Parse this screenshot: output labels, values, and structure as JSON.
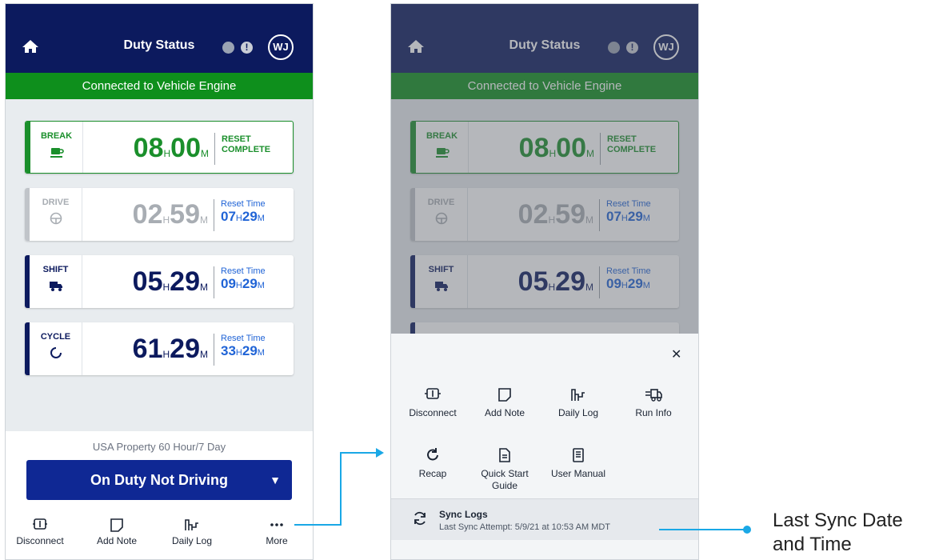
{
  "header": {
    "title": "Duty Status",
    "avatar_initials": "WJ",
    "icons": [
      "home-icon",
      "globe-icon",
      "alert-icon"
    ]
  },
  "connection_banner": "Connected to Vehicle Engine",
  "clocks": {
    "break": {
      "label": "BREAK",
      "hours": "08",
      "minutes": "00",
      "h_unit": "H",
      "m_unit": "M",
      "status_line1": "RESET",
      "status_line2": "COMPLETE",
      "icon": "coffee-icon"
    },
    "drive": {
      "label": "DRIVE",
      "hours": "02",
      "minutes": "59",
      "h_unit": "H",
      "m_unit": "M",
      "reset_label": "Reset Time",
      "reset_hours": "07",
      "reset_minutes": "29",
      "icon": "steering-wheel-icon"
    },
    "shift": {
      "label": "SHIFT",
      "hours": "05",
      "minutes": "29",
      "h_unit": "H",
      "m_unit": "M",
      "reset_label": "Reset Time",
      "reset_hours": "09",
      "reset_minutes": "29",
      "icon": "truck-icon"
    },
    "cycle": {
      "label": "CYCLE",
      "hours": "61",
      "minutes": "29",
      "h_unit": "H",
      "m_unit": "M",
      "reset_label": "Reset Time",
      "reset_hours": "33",
      "reset_minutes": "29",
      "icon": "cycle-icon"
    }
  },
  "ruleset": "USA Property 60 Hour/7 Day",
  "duty_button": "On Duty Not Driving",
  "bottom_nav": {
    "disconnect": "Disconnect",
    "add_note": "Add Note",
    "daily_log": "Daily Log",
    "more": "More"
  },
  "more_menu": {
    "disconnect": "Disconnect",
    "add_note": "Add Note",
    "daily_log": "Daily Log",
    "run_info": "Run Info",
    "recap": "Recap",
    "quick_start_line1": "Quick Start",
    "quick_start_line2": "Guide",
    "user_manual": "User Manual",
    "sync_title": "Sync Logs",
    "sync_sub": "Last Sync Attempt: 5/9/21 at 10:53 AM MDT"
  },
  "annotation": {
    "line1": "Last Sync Date",
    "line2": "and Time"
  },
  "colors": {
    "navy": "#0c1a5e",
    "green": "#0e8f1c",
    "blue_accent": "#1f63d6",
    "callout_blue": "#1aa8e6"
  }
}
